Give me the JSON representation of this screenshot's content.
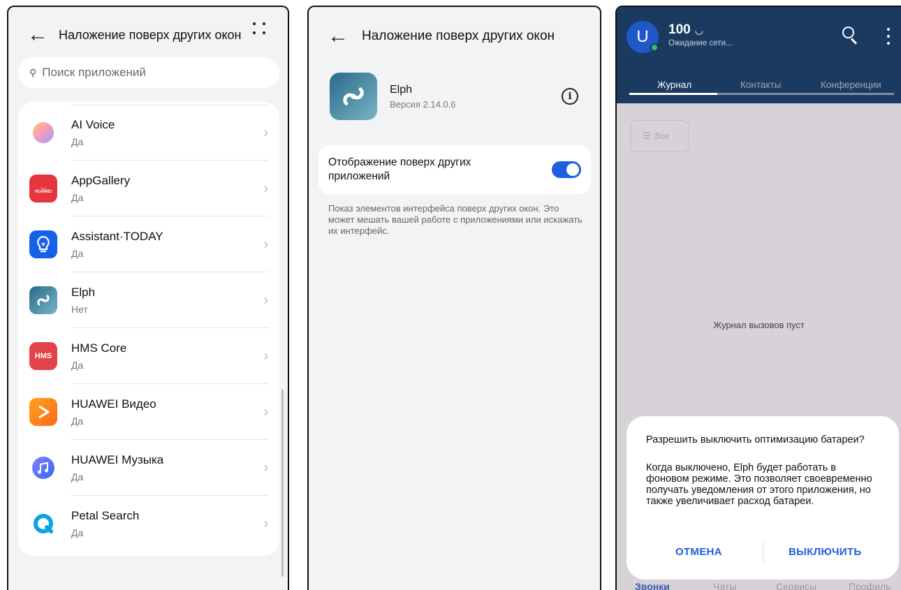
{
  "screen1": {
    "title": "Наложение поверх других окон",
    "search_placeholder": "Поиск приложений",
    "apps": [
      {
        "name": "AI Voice",
        "status": "Да",
        "icon": "ai-voice-icon"
      },
      {
        "name": "AppGallery",
        "status": "Да",
        "icon": "appgallery-icon",
        "badge": "HUAWEI"
      },
      {
        "name": "Assistant·TODAY",
        "status": "Да",
        "icon": "assistant-today-icon"
      },
      {
        "name": "Elph",
        "status": "Нет",
        "icon": "elph-icon"
      },
      {
        "name": "HMS Core",
        "status": "Да",
        "icon": "hms-core-icon",
        "badge": "HMS"
      },
      {
        "name": "HUAWEI Видео",
        "status": "Да",
        "icon": "huawei-video-icon"
      },
      {
        "name": "HUAWEI Музыка",
        "status": "Да",
        "icon": "huawei-music-icon"
      },
      {
        "name": "Petal Search",
        "status": "Да",
        "icon": "petal-search-icon"
      }
    ]
  },
  "screen2": {
    "title": "Наложение поверх других окон",
    "app_name": "Elph",
    "app_version": "Версия 2.14.0.6",
    "setting_label": "Отображение поверх других приложений",
    "setting_enabled": true,
    "description": "Показ элементов интерфейса поверх других окон. Это может мешать вашей работе с приложениями или искажать их интерфейс."
  },
  "screen3": {
    "avatar_letter": "U",
    "balance": "100",
    "network_status": "Ожидание сети...",
    "tabs": [
      "Журнал",
      "Контакты",
      "Конференции"
    ],
    "active_tab": "Журнал",
    "filter_label": "Все",
    "empty_text": "Журнал вызовов пуст",
    "bottom_nav": [
      "Звонки",
      "Чаты",
      "Сервисы",
      "Профиль"
    ],
    "dialog": {
      "title": "Разрешить выключить оптимизацию батареи?",
      "body": "Когда выключено, Elph будет работать в фоновом режиме. Это позволяет своевременно получать уведомления от этого приложения, но также увеличивает расход батареи.",
      "cancel": "ОТМЕНА",
      "confirm": "ВЫКЛЮЧИТЬ"
    }
  },
  "colors": {
    "accent_blue": "#1d5fe0",
    "header_navy": "#1b3a5f",
    "online_green": "#3bb66d"
  }
}
